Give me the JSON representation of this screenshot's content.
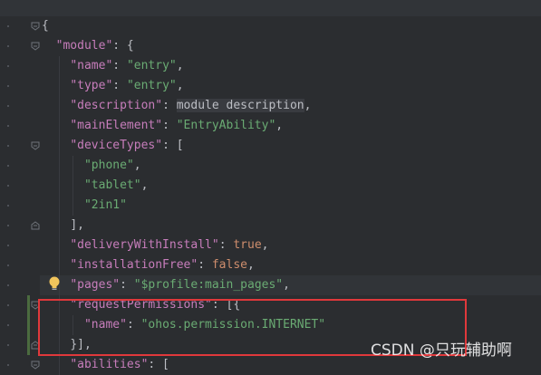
{
  "editor": {
    "lines": [
      {
        "tokens": [
          [
            "punc",
            "{"
          ]
        ]
      },
      {
        "tokens": [
          [
            "key",
            "\"module\""
          ],
          [
            "punc",
            ": {"
          ]
        ]
      },
      {
        "tokens": [
          [
            "key",
            "\"name\""
          ],
          [
            "punc",
            ": "
          ],
          [
            "str",
            "\"entry\""
          ],
          [
            "punc",
            ","
          ]
        ]
      },
      {
        "tokens": [
          [
            "key",
            "\"type\""
          ],
          [
            "punc",
            ": "
          ],
          [
            "str",
            "\"entry\""
          ],
          [
            "punc",
            ","
          ]
        ]
      },
      {
        "tokens": [
          [
            "key",
            "\"description\""
          ],
          [
            "punc",
            ": "
          ],
          [
            "desc",
            "module description"
          ],
          [
            "punc",
            ","
          ]
        ]
      },
      {
        "tokens": [
          [
            "key",
            "\"mainElement\""
          ],
          [
            "punc",
            ": "
          ],
          [
            "str",
            "\"EntryAbility\""
          ],
          [
            "punc",
            ","
          ]
        ]
      },
      {
        "tokens": [
          [
            "key",
            "\"deviceTypes\""
          ],
          [
            "punc",
            ": ["
          ]
        ]
      },
      {
        "tokens": [
          [
            "str",
            "\"phone\""
          ],
          [
            "punc",
            ","
          ]
        ]
      },
      {
        "tokens": [
          [
            "str",
            "\"tablet\""
          ],
          [
            "punc",
            ","
          ]
        ]
      },
      {
        "tokens": [
          [
            "str",
            "\"2in1\""
          ]
        ]
      },
      {
        "tokens": [
          [
            "punc",
            "],"
          ]
        ]
      },
      {
        "tokens": [
          [
            "key",
            "\"deliveryWithInstall\""
          ],
          [
            "punc",
            ": "
          ],
          [
            "kw",
            "true"
          ],
          [
            "punc",
            ","
          ]
        ]
      },
      {
        "tokens": [
          [
            "key",
            "\"installationFree\""
          ],
          [
            "punc",
            ": "
          ],
          [
            "kw",
            "false"
          ],
          [
            "punc",
            ","
          ]
        ]
      },
      {
        "tokens": [
          [
            "key",
            "\"pages\""
          ],
          [
            "punc",
            ": "
          ],
          [
            "str",
            "\"$profile:main_pages\""
          ],
          [
            "punc",
            ","
          ]
        ]
      },
      {
        "tokens": [
          [
            "key",
            "\"requestPermissions\""
          ],
          [
            "punc",
            ": [{"
          ]
        ]
      },
      {
        "tokens": [
          [
            "key",
            "\"name\""
          ],
          [
            "punc",
            ": "
          ],
          [
            "str",
            "\"ohos.permission.INTERNET\""
          ]
        ]
      },
      {
        "tokens": [
          [
            "punc",
            "}],"
          ]
        ]
      },
      {
        "tokens": [
          [
            "key",
            "\"abilities\""
          ],
          [
            "punc",
            ": ["
          ]
        ]
      }
    ]
  },
  "colors": {
    "key": "#c77dbb",
    "string": "#6aab73",
    "keyword": "#cf8e6d",
    "text": "#bcbec4",
    "background": "#2b2d30",
    "annotation_box": "#e0383b"
  },
  "icons": {
    "fold": "fold-marker-icon",
    "intention": "lightbulb-icon"
  },
  "watermark": {
    "text": "CSDN @只玩辅助啊"
  }
}
